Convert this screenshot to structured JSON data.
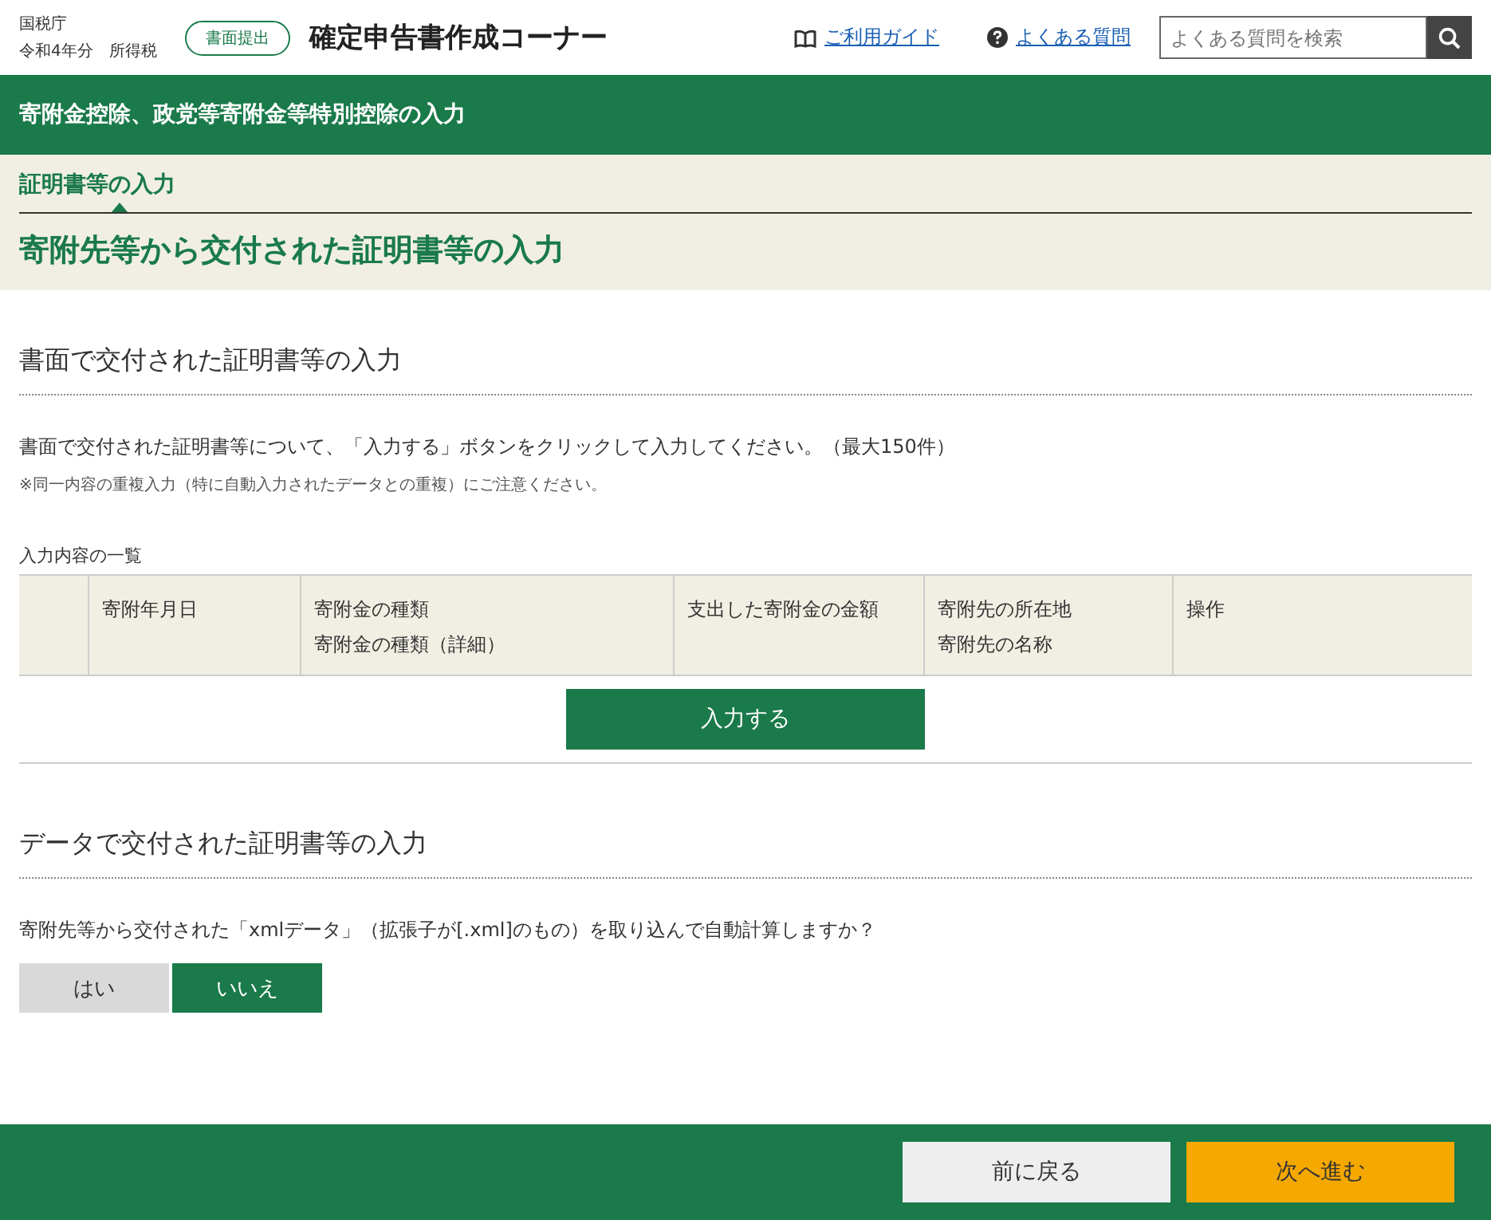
{
  "header": {
    "agency": "国税庁",
    "year_tax": "令和4年分　所得税",
    "mode_badge": "書面提出",
    "title": "確定申告書作成コーナー",
    "links": [
      {
        "label": "ご利用ガイド",
        "kind": "book"
      },
      {
        "label": "よくある質問",
        "kind": "question"
      }
    ],
    "search": {
      "placeholder": "よくある質問を検索"
    }
  },
  "page_bar": {
    "title": "寄附金控除、政党等寄附金等特別控除の入力"
  },
  "step": {
    "tab": "証明書等の入力",
    "title": "寄附先等から交付された証明書等の入力"
  },
  "paper_section": {
    "heading": "書面で交付された証明書等の入力",
    "description": "書面で交付された証明書等について、「入力する」ボタンをクリックして入力してください。（最大150件）",
    "note": "※同一内容の重複入力（特に自動入力されたデータとの重複）にご注意ください。",
    "table_caption": "入力内容の一覧",
    "columns": [
      {
        "kind": "blank"
      },
      {
        "kind": "label",
        "lines": [
          "寄附年月日"
        ]
      },
      {
        "kind": "label",
        "lines": [
          "寄附金の種類",
          "寄附金の種類（詳細）"
        ]
      },
      {
        "kind": "label",
        "lines": [
          "支出した寄附金の金額"
        ]
      },
      {
        "kind": "label",
        "lines": [
          "寄附先の所在地",
          "寄附先の名称"
        ]
      },
      {
        "kind": "label",
        "lines": [
          "操作"
        ]
      }
    ],
    "add_button": "入力する"
  },
  "data_section": {
    "heading": "データで交付された証明書等の入力",
    "question": "寄附先等から交付された「xmlデータ」（拡張子が[.xml]のもの）を取り込んで自動計算しますか？",
    "options": [
      {
        "label": "はい",
        "selected": false
      },
      {
        "label": "いいえ",
        "selected": true
      }
    ]
  },
  "footer": {
    "buttons": [
      {
        "label": "前に戻る",
        "kind": "back"
      },
      {
        "label": "次へ進む",
        "kind": "next"
      }
    ]
  }
}
